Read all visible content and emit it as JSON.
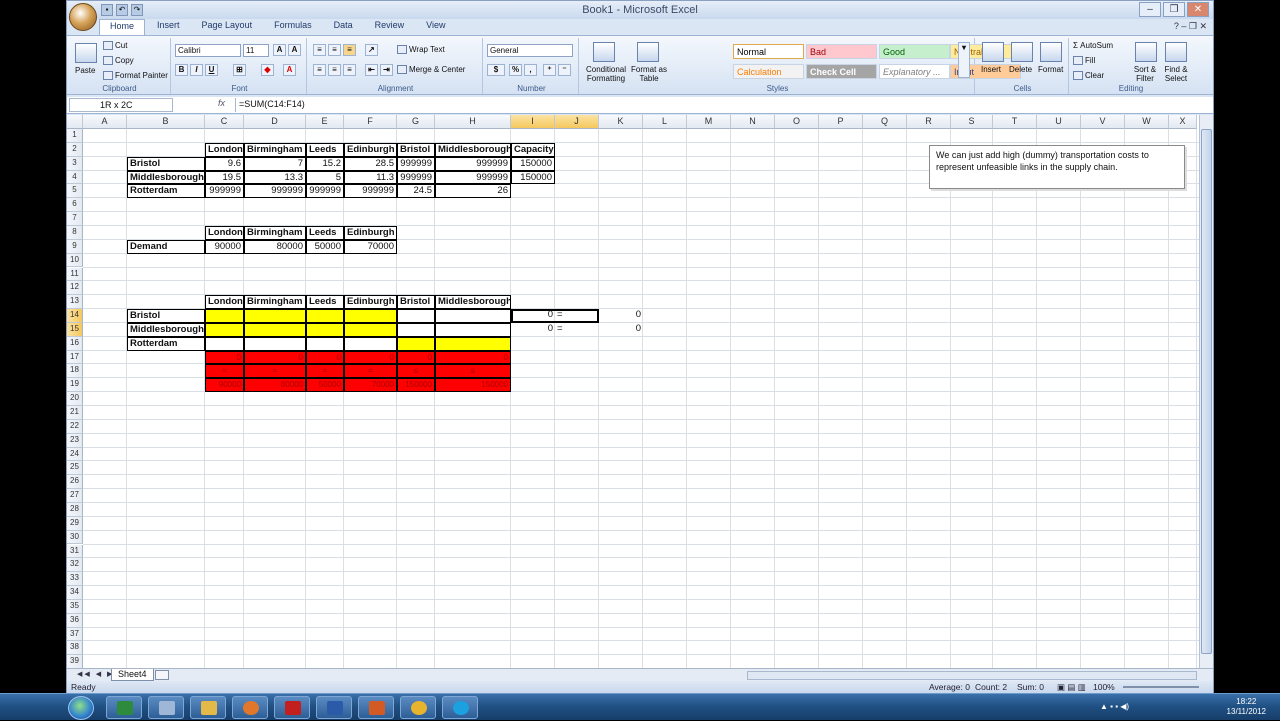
{
  "window": {
    "title": "Book1 - Microsoft Excel"
  },
  "tabs": [
    "Home",
    "Insert",
    "Page Layout",
    "Formulas",
    "Data",
    "Review",
    "View"
  ],
  "ribbon": {
    "clipboard": {
      "label": "Clipboard",
      "paste": "Paste",
      "cut": "Cut",
      "copy": "Copy",
      "format_painter": "Format Painter"
    },
    "font": {
      "label": "Font",
      "name": "Calibri",
      "size": "11",
      "bold": "B",
      "italic": "I",
      "underline": "U"
    },
    "alignment": {
      "label": "Alignment",
      "wrap": "Wrap Text",
      "merge": "Merge & Center"
    },
    "number": {
      "label": "Number",
      "format": "General",
      "percent": "%",
      "comma": ","
    },
    "styles": {
      "label": "Styles",
      "conditional": "Conditional Formatting",
      "format_table": "Format as Table",
      "items": [
        {
          "name": "Normal",
          "bg": "#ffffff",
          "fg": "#000000"
        },
        {
          "name": "Bad",
          "bg": "#ffc7ce",
          "fg": "#9c0006"
        },
        {
          "name": "Good",
          "bg": "#c6efce",
          "fg": "#006100"
        },
        {
          "name": "Neutral",
          "bg": "#ffeb9c",
          "fg": "#9c6500"
        },
        {
          "name": "Calculation",
          "bg": "#f2f2f2",
          "fg": "#fa7d00"
        },
        {
          "name": "Check Cell",
          "bg": "#a5a5a5",
          "fg": "#ffffff"
        },
        {
          "name": "Explanatory ...",
          "bg": "#ffffff",
          "fg": "#7f7f7f"
        },
        {
          "name": "Input",
          "bg": "#ffcc99",
          "fg": "#3f3f76"
        }
      ]
    },
    "cells": {
      "label": "Cells",
      "insert": "Insert",
      "delete": "Delete",
      "format": "Format"
    },
    "editing": {
      "label": "Editing",
      "autosum": "AutoSum",
      "fill": "Fill",
      "clear": "Clear",
      "sort": "Sort & Filter",
      "find": "Find & Select"
    }
  },
  "formula_bar": {
    "name_box": "1R x 2C",
    "fx": "fx",
    "formula": "=SUM(C14:F14)"
  },
  "columns": [
    "A",
    "B",
    "C",
    "D",
    "E",
    "F",
    "G",
    "H",
    "I",
    "J",
    "K",
    "L",
    "M",
    "N",
    "O",
    "P",
    "Q",
    "R",
    "S",
    "T",
    "U",
    "V",
    "W",
    "X"
  ],
  "rows": [
    "1",
    "2",
    "3",
    "4",
    "5",
    "6",
    "7",
    "8",
    "9",
    "10",
    "11",
    "12",
    "13",
    "14",
    "15",
    "16",
    "17",
    "18",
    "19",
    "20",
    "21",
    "22",
    "23",
    "24",
    "25",
    "26",
    "27",
    "28",
    "29",
    "30",
    "31",
    "32",
    "33",
    "34",
    "35",
    "36",
    "37",
    "38",
    "39"
  ],
  "cost_table": {
    "headers": [
      "London",
      "Birmingham",
      "Leeds",
      "Edinburgh",
      "Bristol",
      "Middlesborough",
      "Capacity"
    ],
    "rows": [
      {
        "label": "Bristol",
        "values": [
          "9.6",
          "7",
          "15.2",
          "28.5",
          "999999",
          "999999",
          "150000"
        ]
      },
      {
        "label": "Middlesborough",
        "values": [
          "19.5",
          "13.3",
          "5",
          "11.3",
          "999999",
          "999999",
          "150000"
        ]
      },
      {
        "label": "Rotterdam",
        "values": [
          "999999",
          "999999",
          "999999",
          "999999",
          "24.5",
          "26"
        ]
      }
    ]
  },
  "demand_table": {
    "headers": [
      "London",
      "Birmingham",
      "Leeds",
      "Edinburgh"
    ],
    "label": "Demand",
    "values": [
      "90000",
      "80000",
      "50000",
      "70000"
    ]
  },
  "flow_table": {
    "headers": [
      "London",
      "Birmingham",
      "Leeds",
      "Edinburgh",
      "Bristol",
      "Middlesborough"
    ],
    "rows": [
      "Bristol",
      "Middlesborough",
      "Rotterdam"
    ],
    "totals": [
      "0",
      "0",
      "0",
      "0",
      "0",
      "0"
    ],
    "signs": [
      "=",
      "=",
      "=",
      "=",
      "≤",
      "≤"
    ],
    "targets": [
      "90000",
      "80000",
      "50000",
      "70000",
      "150000",
      "150000"
    ],
    "side": [
      {
        "i": "0",
        "j": "=",
        "k": "0"
      },
      {
        "i": "0",
        "j": "=",
        "k": "0"
      }
    ]
  },
  "note": "We can just add high (dummy) transportation costs to represent unfeasible links in the supply chain.",
  "sheet_tab": "Sheet4",
  "status": {
    "ready": "Ready",
    "average": "Average: 0",
    "count": "Count: 2",
    "sum": "Sum: 0",
    "zoom": "100%"
  },
  "taskbar": {
    "time": "18:22",
    "date": "13/11/2012"
  },
  "colors": {
    "yellow": "#ffff00",
    "red": "#ff0000"
  }
}
